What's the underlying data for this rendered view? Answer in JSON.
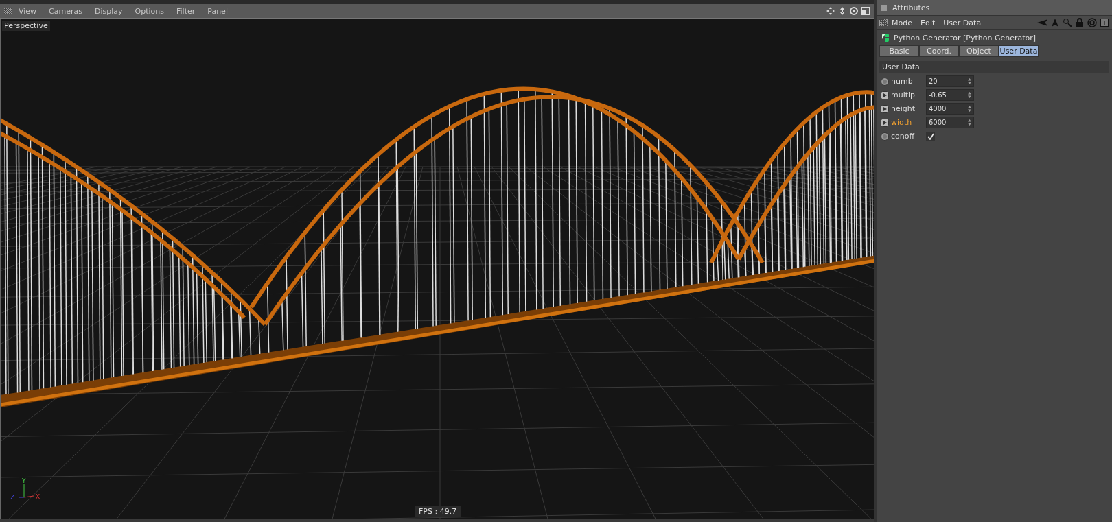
{
  "viewport": {
    "menu": [
      "View",
      "Cameras",
      "Display",
      "Options",
      "Filter",
      "Panel"
    ],
    "camera": "Perspective",
    "fps": "FPS : 49.7",
    "axes": {
      "x": "X",
      "y": "Y",
      "z": "Z"
    }
  },
  "attributes": {
    "title": "Attributes",
    "menu": [
      "Mode",
      "Edit",
      "User Data"
    ],
    "object": "Python Generator [Python Generator]",
    "tabs": [
      {
        "label": "Basic",
        "selected": false
      },
      {
        "label": "Coord.",
        "selected": false
      },
      {
        "label": "Object",
        "selected": false
      },
      {
        "label": "User Data",
        "selected": true
      }
    ],
    "section": "User Data",
    "params": [
      {
        "kind": "number",
        "label": "numb",
        "value": "20",
        "animated": false,
        "highlighted": false
      },
      {
        "kind": "number",
        "label": "multip",
        "value": "-0.65",
        "animated": true,
        "highlighted": false
      },
      {
        "kind": "number",
        "label": "height",
        "value": "4000",
        "animated": true,
        "highlighted": false
      },
      {
        "kind": "number",
        "label": "width",
        "value": "6000",
        "animated": true,
        "highlighted": true
      },
      {
        "kind": "checkbox",
        "label": "conoff",
        "checked": true,
        "animated": false,
        "highlighted": false
      }
    ]
  }
}
